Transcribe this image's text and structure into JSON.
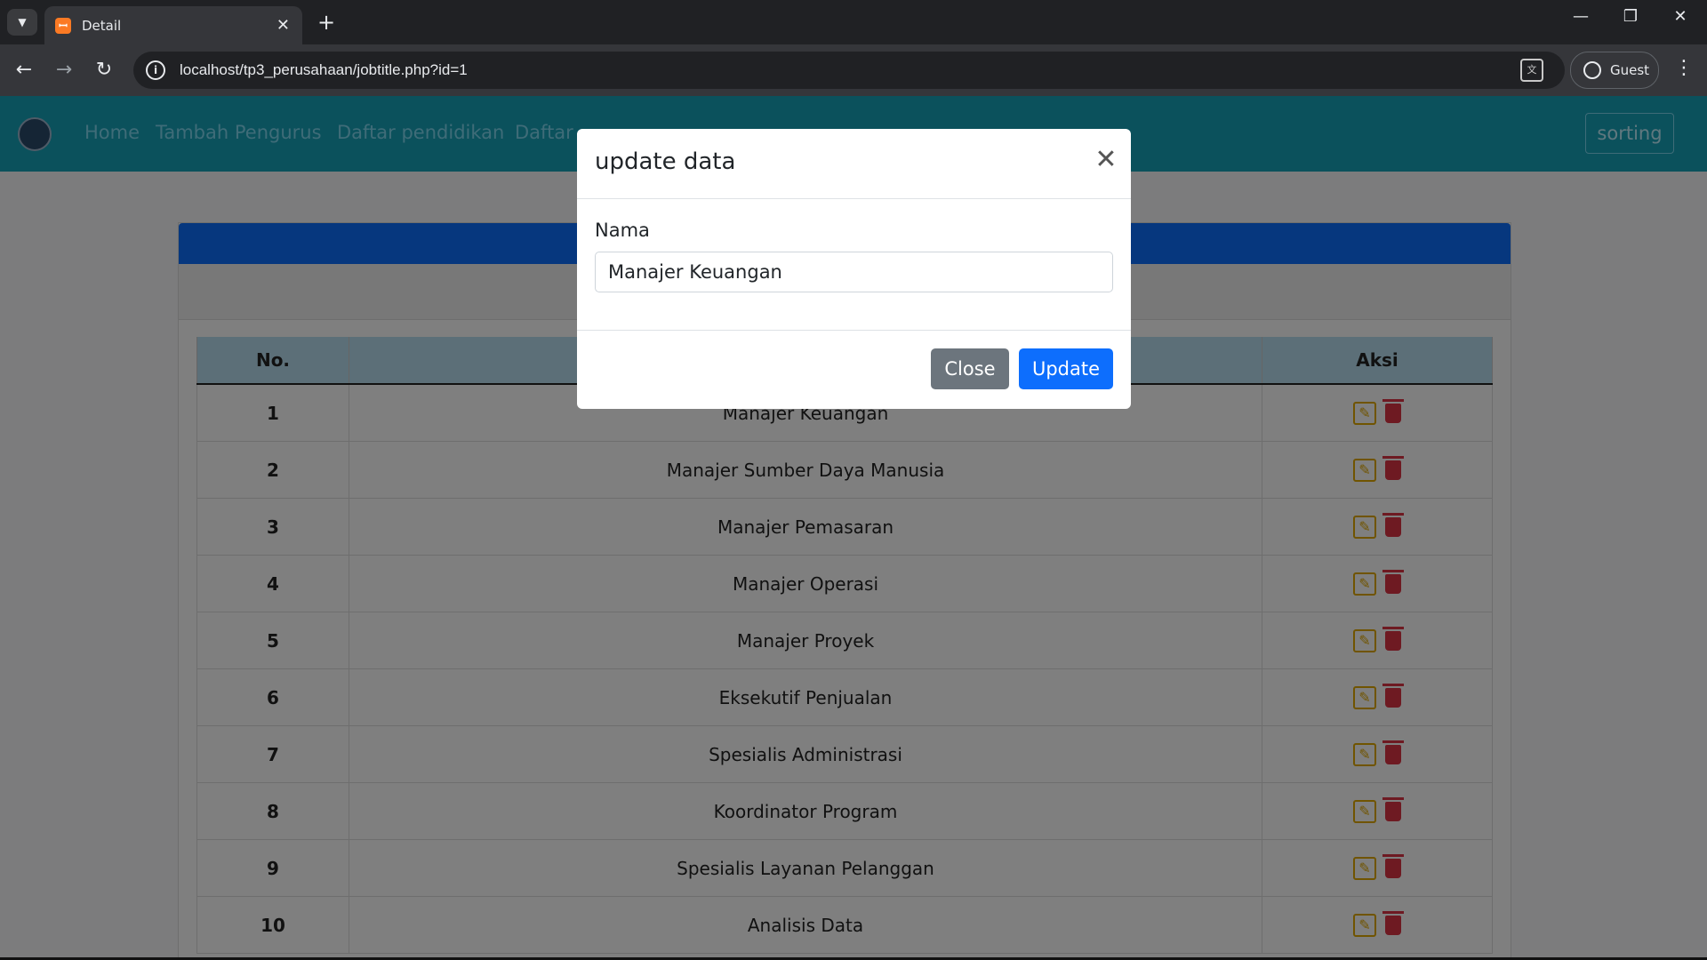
{
  "browser": {
    "tab_title": "Detail",
    "favicon_glyph": "ꟷ",
    "new_tab": "+",
    "url": "localhost/tp3_perusahaan/jobtitle.php?id=1",
    "profile_label": "Guest",
    "info_glyph": "i",
    "translate_glyph": "文"
  },
  "navbar": {
    "links": [
      "Home",
      "Tambah Pengurus",
      "Daftar pendidikan",
      "Daftar"
    ],
    "sorting_label": "sorting"
  },
  "table": {
    "headers": [
      "No.",
      "",
      "Aksi"
    ],
    "rows": [
      {
        "no": "1",
        "name": "Manajer Keuangan"
      },
      {
        "no": "2",
        "name": "Manajer Sumber Daya Manusia"
      },
      {
        "no": "3",
        "name": "Manajer Pemasaran"
      },
      {
        "no": "4",
        "name": "Manajer Operasi"
      },
      {
        "no": "5",
        "name": "Manajer Proyek"
      },
      {
        "no": "6",
        "name": "Eksekutif Penjualan"
      },
      {
        "no": "7",
        "name": "Spesialis Administrasi"
      },
      {
        "no": "8",
        "name": "Koordinator Program"
      },
      {
        "no": "9",
        "name": "Spesialis Layanan Pelanggan"
      },
      {
        "no": "10",
        "name": "Analisis Data"
      }
    ]
  },
  "modal": {
    "title": "update data",
    "field_label": "Nama",
    "field_value": "Manajer Keuangan",
    "close_label": "Close",
    "update_label": "Update"
  },
  "colors": {
    "navbar": "#17a2b8",
    "primary": "#0d6efd",
    "secondary": "#6c757d",
    "edit": "#e0a800",
    "delete": "#dc3545"
  }
}
